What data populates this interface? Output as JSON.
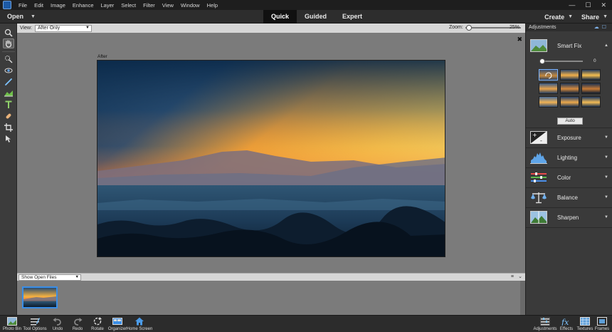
{
  "menubar": {
    "items": [
      "File",
      "Edit",
      "Image",
      "Enhance",
      "Layer",
      "Select",
      "Filter",
      "View",
      "Window",
      "Help"
    ],
    "window_controls": [
      "—",
      "☐",
      "✕"
    ]
  },
  "modebar": {
    "open_label": "Open",
    "tabs": [
      {
        "label": "Quick",
        "active": true
      },
      {
        "label": "Guided",
        "active": false
      },
      {
        "label": "Expert",
        "active": false
      }
    ],
    "create_label": "Create",
    "share_label": "Share"
  },
  "tools": [
    "zoom-icon",
    "hand-icon",
    "quick-selection-icon",
    "red-eye-icon",
    "whiten-teeth-icon",
    "straighten-icon",
    "type-icon",
    "spot-healing-icon",
    "crop-icon",
    "move-icon"
  ],
  "options": {
    "view_label": "View:",
    "view_value": "After Only",
    "zoom_label": "Zoom:",
    "zoom_value": "25%",
    "zoom_fraction": 0.02
  },
  "canvas": {
    "after_label": "After",
    "close_glyph": "✖"
  },
  "photo_bin": {
    "select_value": "Show Open Files"
  },
  "adjustments": {
    "title": "Adjustments",
    "smart_fix": {
      "label": "Smart Fix",
      "value": "0"
    },
    "auto_label": "Auto",
    "items": [
      {
        "label": "Exposure",
        "icon": "exposure-icon"
      },
      {
        "label": "Lighting",
        "icon": "lighting-icon"
      },
      {
        "label": "Color",
        "icon": "color-icon"
      },
      {
        "label": "Balance",
        "icon": "balance-icon"
      },
      {
        "label": "Sharpen",
        "icon": "sharpen-icon"
      }
    ]
  },
  "bottombar": {
    "left": [
      {
        "label": "Photo Bin",
        "icon": "photo-bin-icon"
      },
      {
        "label": "Tool Options",
        "icon": "tool-options-icon"
      },
      {
        "label": "Undo",
        "icon": "undo-icon"
      },
      {
        "label": "Redo",
        "icon": "redo-icon"
      },
      {
        "label": "Rotate",
        "icon": "rotate-icon"
      },
      {
        "label": "Organizer",
        "icon": "organizer-icon"
      },
      {
        "label": "Home Screen",
        "icon": "home-icon"
      }
    ],
    "right": [
      {
        "label": "Adjustments",
        "icon": "adjustments-icon"
      },
      {
        "label": "Effects",
        "icon": "effects-icon"
      },
      {
        "label": "Textures",
        "icon": "textures-icon"
      },
      {
        "label": "Frames",
        "icon": "frames-icon"
      }
    ]
  },
  "colors": {
    "accent": "#3a8ee6",
    "panel_bg": "#3a3a3a",
    "canvas_bg": "#7b7b7b"
  }
}
